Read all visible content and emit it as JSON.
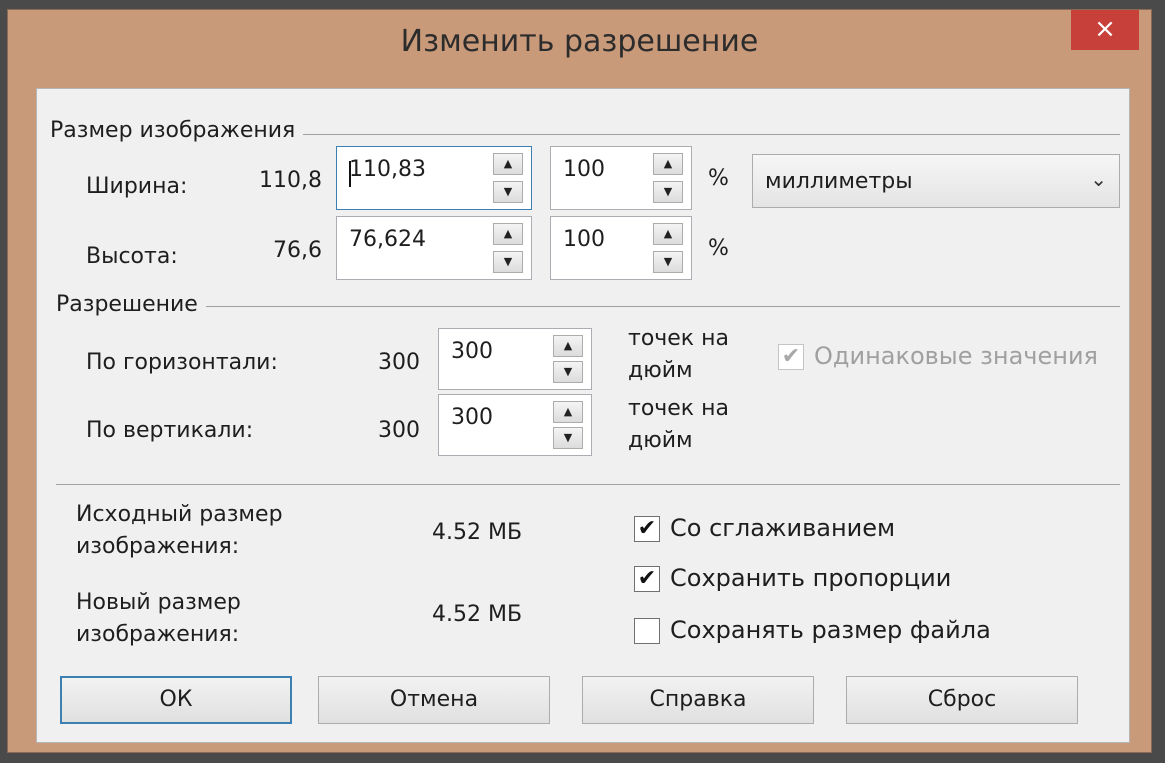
{
  "dialog": {
    "title": "Изменить разрешение",
    "close_label": "×"
  },
  "image_size": {
    "group_title": "Размер изображения",
    "width": {
      "label": "Ширина:",
      "current": "110,8",
      "value": "110,83",
      "percent": "100",
      "percent_sign": "%"
    },
    "height": {
      "label": "Высота:",
      "current": "76,6",
      "value": "76,624",
      "percent": "100",
      "percent_sign": "%"
    },
    "units": {
      "selected": "миллиметры"
    }
  },
  "resolution": {
    "group_title": "Разрешение",
    "horizontal": {
      "label": "По горизонтали:",
      "current": "300",
      "value": "300",
      "unit_line1": "точек на",
      "unit_line2": "дюйм"
    },
    "vertical": {
      "label": "По вертикали:",
      "current": "300",
      "value": "300",
      "unit_line1": "точек на",
      "unit_line2": "дюйм"
    },
    "identical_values": {
      "label": "Одинаковые значения",
      "checked": true,
      "disabled": true
    }
  },
  "sizes": {
    "original_label_1": "Исходный размер",
    "original_label_2": "изображения:",
    "original_value": "4.52 МБ",
    "new_label_1": "Новый размер",
    "new_label_2": "изображения:",
    "new_value": "4.52 МБ"
  },
  "options": {
    "antialias": {
      "label": "Со сглаживанием",
      "checked": true
    },
    "keep_proportions": {
      "label": "Сохранить пропорции",
      "checked": true
    },
    "keep_file_size": {
      "label": "Сохранять размер файла",
      "checked": false
    }
  },
  "buttons": {
    "ok": "ОК",
    "cancel": "Отмена",
    "help": "Справка",
    "reset": "Сброс"
  },
  "icons": {
    "check": "✔",
    "up": "▲",
    "down": "▼",
    "chevron": "⌄"
  }
}
